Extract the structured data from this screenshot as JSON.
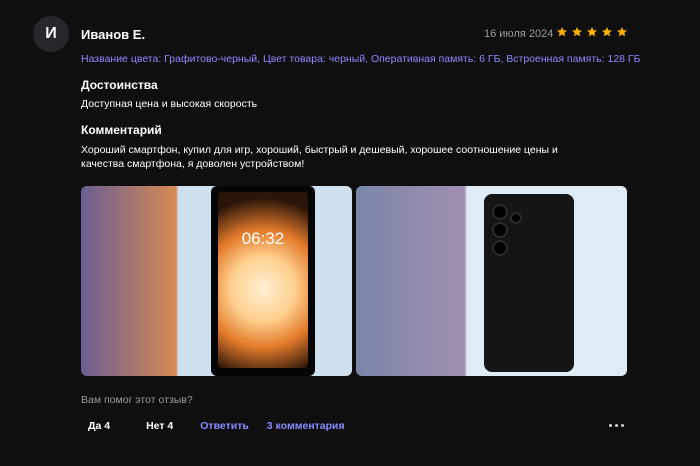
{
  "review": {
    "avatar_letter": "И",
    "author": "Иванов Е.",
    "date": "16 июля 2024",
    "rating": 5,
    "attributes": "Название цвета: Графитово-черный, Цвет товара: черный, Оперативная память: 6 ГБ, Встроенная память: 128 ГБ",
    "pros_title": "Достоинства",
    "pros_text": "Доступная цена и высокая скорость",
    "comment_title": "Комментарий",
    "comment_text": "Хороший смартфон, купил для игр, хороший, быстрый и дешевый, хорошее соотношение цены и качества смартфона, я доволен устройством!"
  },
  "photos": {
    "photo1_time": "06:32"
  },
  "footer": {
    "helpful_question": "Вам помог этот отзыв?",
    "yes_label": "Да 4",
    "no_label": "Нет 4",
    "reply_label": "Ответить",
    "comments_label": "3 комментария"
  },
  "colors": {
    "accent": "#8a8bff",
    "star": "#ffb100",
    "background": "#0f0f10"
  },
  "icons": [
    "star-icon",
    "more-icon"
  ]
}
